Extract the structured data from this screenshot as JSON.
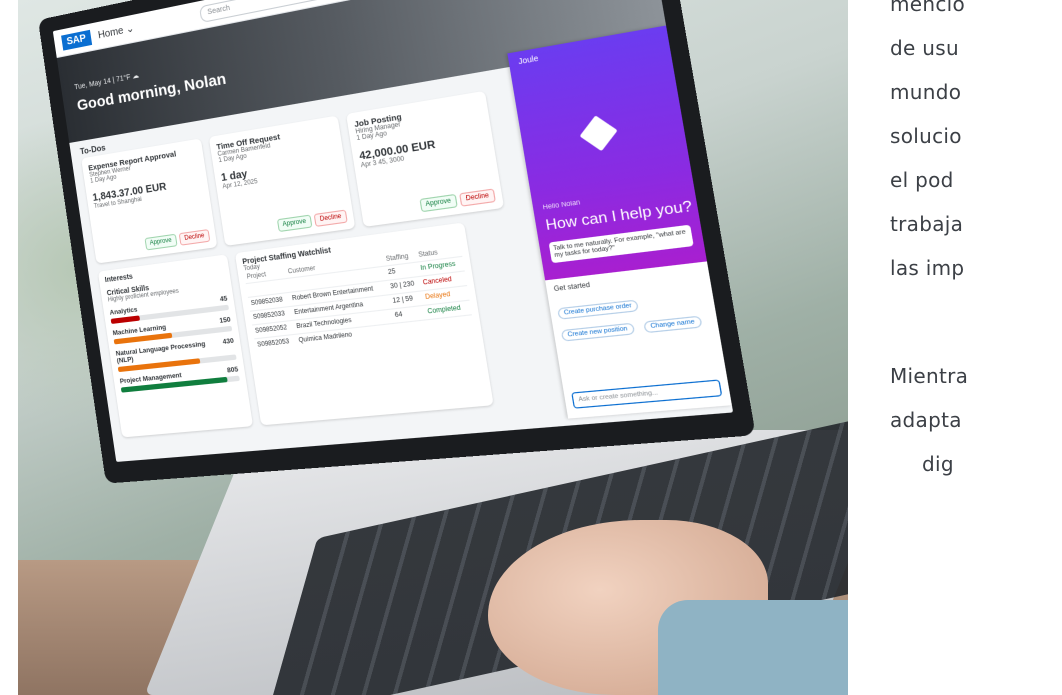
{
  "app": {
    "logo": "SAP",
    "home_label": "Home ⌄",
    "search_placeholder": "Search",
    "hero_date": "Tue, May 14 | 71°F ☁",
    "greeting": "Good morning, Nolan"
  },
  "todos": {
    "title": "To-Dos",
    "cards": [
      {
        "title": "Expense Report Approval",
        "person": "Stephen Werner",
        "time": "1 Day Ago",
        "amount": "1,843.37.00 EUR",
        "note": "Travel to Shanghai",
        "approve": "Approve",
        "decline": "Decline"
      },
      {
        "title": "Time Off Request",
        "person": "Carmen Bamenfeld",
        "time": "1 Day Ago",
        "amount": "1 day",
        "note": "Apr 12, 2025",
        "approve": "Approve",
        "decline": "Decline"
      },
      {
        "title": "Job Posting",
        "person": "Hiring Manager",
        "time": "1 Day Ago",
        "amount": "42,000.00 EUR",
        "note": "Apr 3 45, 3000",
        "approve": "Approve",
        "decline": "Decline"
      }
    ]
  },
  "interests": {
    "title": "Interests",
    "heading": "Critical Skills",
    "subheading": "Highly proficient employees",
    "skills": [
      {
        "name": "Analytics",
        "count": "45",
        "level": 0.25,
        "color": "#bb0000"
      },
      {
        "name": "Machine Learning",
        "count": "150",
        "level": 0.5,
        "color": "#e9730c"
      },
      {
        "name": "Natural Language Processing (NLP)",
        "count": "430",
        "level": 0.7,
        "color": "#e9730c"
      },
      {
        "name": "Project Management",
        "count": "805",
        "level": 0.9,
        "color": "#107e3e"
      }
    ]
  },
  "staffing": {
    "title": "Project Staffing Watchlist",
    "subtitle": "Today",
    "headers": [
      "Project",
      "Customer",
      "Staffing",
      "Status"
    ],
    "rows": [
      {
        "project": "",
        "customer": "",
        "staffing": "25",
        "status": "In Progress",
        "status_color": "#107e3e"
      },
      {
        "project": "S09852038",
        "customer": "Robert Brown Entertainment",
        "staffing": "30 | 230",
        "status": "Canceled",
        "status_color": "#bb0000"
      },
      {
        "project": "S09852033",
        "customer": "Entertainment Argentina",
        "staffing": "12 | 59",
        "status": "Delayed",
        "status_color": "#e9730c"
      },
      {
        "project": "S09852052",
        "customer": "Brazil Technologies",
        "staffing": "64",
        "status": "Completed",
        "status_color": "#107e3e"
      },
      {
        "project": "S09852053",
        "customer": "Quimica Madrileno",
        "staffing": "",
        "status": "",
        "status_color": "#107e3e"
      }
    ]
  },
  "joule": {
    "name": "Joule",
    "hello": "Hello Nolan",
    "how": "How can I help you?",
    "prompt": "Talk to me naturally. For example, \"what are my tasks for today?\"",
    "get_started": "Get started",
    "chips": [
      "Create purchase order",
      "Create new position",
      "Change name"
    ],
    "ask_placeholder": "Ask or create something..."
  },
  "side_text": {
    "lines": [
      "mencio",
      "de   usu",
      "mundo",
      "solucio",
      "el   pod",
      "trabaja",
      "las imp",
      "",
      "Mientra",
      "adapta",
      "dig"
    ]
  }
}
